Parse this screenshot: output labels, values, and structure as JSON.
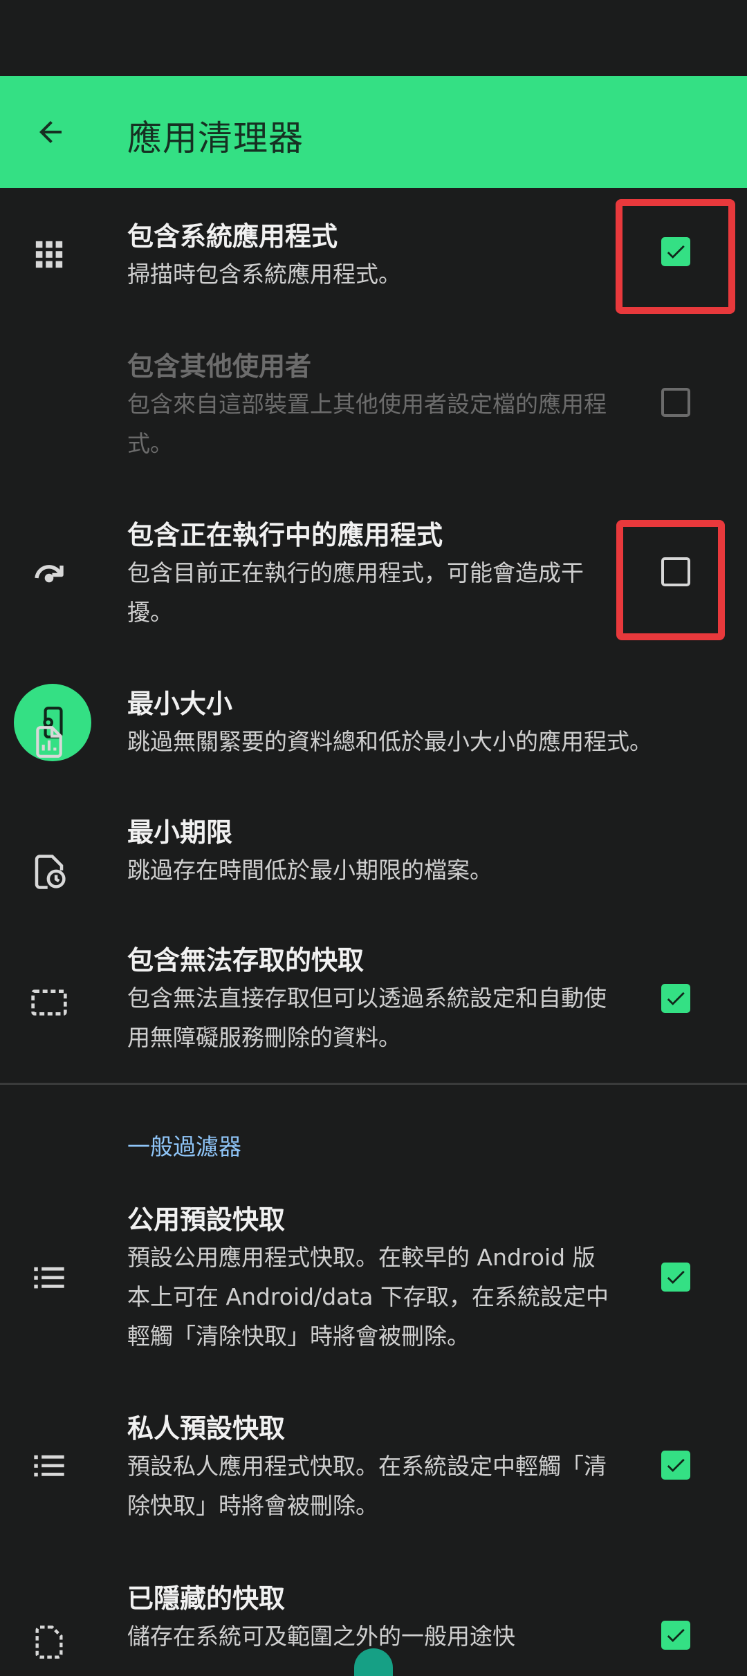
{
  "header": {
    "title": "應用清理器",
    "back_icon": "arrow-left-icon"
  },
  "items": [
    {
      "title": "包含系統應用程式",
      "subtitle": "掃描時包含系統應用程式。",
      "icon": "apps-grid-icon",
      "checked": true
    },
    {
      "title": "包含其他使用者",
      "subtitle": "包含來自這部裝置上其他使用者設定檔的應用程式。",
      "icon": "user-device-settings-icon",
      "checked": false,
      "disabled": true
    },
    {
      "title": "包含正在執行中的應用程式",
      "subtitle": "包含目前正在執行的應用程式，可能會造成干擾。",
      "icon": "redo-arrow-icon",
      "checked": false
    },
    {
      "title": "最小大小",
      "subtitle": "跳過無關緊要的資料總和低於最小大小的應用程式。",
      "icon": "file-chart-icon"
    },
    {
      "title": "最小期限",
      "subtitle": "跳過存在時間低於最小期限的檔案。",
      "icon": "file-clock-icon"
    },
    {
      "title": "包含無法存取的快取",
      "subtitle": "包含無法直接存取但可以透過系統設定和自動使用無障礙服務刪除的資料。",
      "icon": "dashed-rectangle-icon",
      "checked": true
    }
  ],
  "section": {
    "title": "一般過濾器"
  },
  "filters": [
    {
      "title": "公用預設快取",
      "subtitle": "預設公用應用程式快取。在較早的 Android 版本上可在 Android/data 下存取，在系統設定中輕觸「清除快取」時將會被刪除。",
      "icon": "list-icon",
      "checked": true
    },
    {
      "title": "私人預設快取",
      "subtitle": "預設私人應用程式快取。在系統設定中輕觸「清除快取」時將會被刪除。",
      "icon": "list-icon",
      "checked": true
    },
    {
      "title": "已隱藏的快取",
      "subtitle": "儲存在系統可及範圍之外的一般用途快",
      "icon": "dashed-file-icon",
      "checked": true
    }
  ],
  "colors": {
    "accent": "#34e084",
    "background": "#1b1c1c",
    "highlight": "#e8393c",
    "section": "#8fc5f8"
  }
}
